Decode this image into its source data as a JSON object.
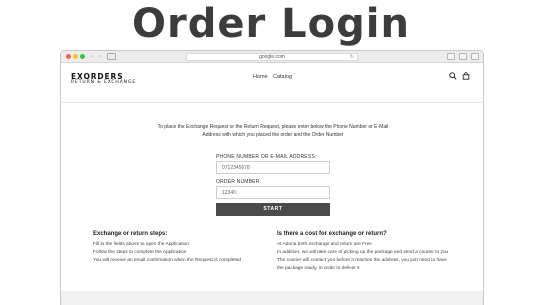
{
  "headline": "Order Login",
  "browser": {
    "url": "google.com",
    "back_icon": "chevron-left-icon",
    "forward_icon": "chevron-right-icon",
    "reload_icon": "reload-icon"
  },
  "header": {
    "logo_main": "EXORDERS",
    "logo_sub": "RETURN & EXCHANGE",
    "nav": [
      "Home",
      "Catalog"
    ],
    "icons": [
      "search-icon",
      "shopping-bag-icon"
    ]
  },
  "form": {
    "intro_line1": "To place the Exchange Request or the Return Request, please enter below the Phone Number or E-Mail",
    "intro_line2": "Address with which you placed the order and the Order Number",
    "phone_label": "PHONE NUMBER OR E-MAIL ADDRESS:",
    "phone_value": "0712345678",
    "order_label": "ORDER NUMBER:",
    "order_value": "12340",
    "start_label": "START"
  },
  "info": {
    "left_title": "Exchange or return steps:",
    "left_lines": [
      "Fill in the fields above to open the Application",
      "Follow the steps to complete the Application",
      "You will receive an email confirmation when the Request is completed"
    ],
    "right_title": "Is there a cost for exchange or return?",
    "right_lines": [
      "At Adona both exchange and return are Free",
      "In addition, we will take care of picking up the package and send a courier to you",
      "The courier will contact you before it reaches the address, you just need to have",
      "the package ready, in order to deliver it"
    ]
  }
}
